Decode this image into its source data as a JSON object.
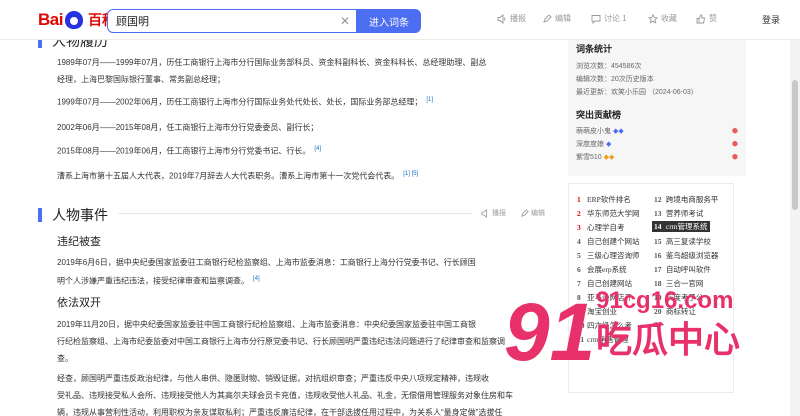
{
  "header": {
    "logo_bai": "Bai",
    "logo_du": "du",
    "logo_baike": "百科",
    "search_value": "顾国明",
    "search_placeholder": "",
    "enter_button": "进入词条",
    "tools": {
      "play": "播报",
      "edit": "编辑",
      "discuss": "讨论 1",
      "collect": "收藏",
      "like": "赞"
    },
    "login": "登录"
  },
  "main": {
    "career_heading_partial": "人物履历",
    "career": [
      {
        "text": "1989年07月——1999年07月，历任工商银行上海市分行国际业务部科员、资金科副科长、资金科科长、总经理助理、副总",
        "sup": ""
      },
      {
        "text": "经理，上海巴黎国际银行董事、常务副总经理；",
        "sup": ""
      },
      {
        "text": "1999年07月——2002年06月，历任工商银行上海市分行国际业务处代处长、处长，国际业务部总经理；",
        "sup": "[1]"
      },
      {
        "text": "2002年06月——2015年08月，任工商银行上海市分行党委委员、副行长；",
        "sup": ""
      },
      {
        "text": "2015年08月——2019年06月，任工商银行上海市分行党委书记、行长。",
        "sup": "[4]"
      },
      {
        "text": "漕系上海市第十五届人大代表，2019年7月辞去人大代表职务。漕系上海市第十一次党代会代表。",
        "sup": "[1]  [5]"
      }
    ],
    "events_heading": "人物事件",
    "events_tools": {
      "play": "播报",
      "edit": "编辑"
    },
    "sub1_title": "违纪被查",
    "sub1_lines": [
      "2019年6月6日，据中央纪委国家监委驻工商银行纪检监察组、上海市监委消息：工商银行上海分行党委书记、行长顾国",
      "明个人涉嫌严重违纪违法，接受纪律审查和监察调查。"
    ],
    "sub1_sup": "[4]",
    "sub2_title": "依法双开",
    "sub2_lines": [
      "2019年11月20日，据中央纪委国家监委驻中国工商银行纪检监察组、上海市监委消息：中央纪委国家监委驻中国工商银",
      "行纪检监察组、上海市纪委监委对中国工商银行上海市分行原党委书记、行长顾国明严重违纪违法问题进行了纪律审查和监察调",
      "查。"
    ],
    "sub2_p2_lines": [
      "经查，顾国明严重违反政治纪律，与他人串供、隐匿财物、销毁证据，对抗组织审查；严重违反中央八项规定精神，违规收",
      "受礼品、违规接受私人会所、违规接受他人为其高尔夫球会员卡充值，违规收受他人礼品、礼金，无偿借用管理服务对象住房和车",
      "辆，违规从事营利性活动，利用职权为亲友谋取私利；严重违反廉洁纪律，在干部选拔任用过程中，为关系人“量身定做”选拔任"
    ]
  },
  "sidebar": {
    "stats_title": "词条统计",
    "stats": [
      "浏览次数：454586次",
      "编辑次数：20次历史版本",
      "最近更新：欢笑小乐园 （2024-06-03）"
    ],
    "contrib_title": "突出贡献榜",
    "contributors": [
      "萌萌皮小鬼",
      "深度度娘",
      "紫雪510"
    ],
    "rank_items": [
      {
        "num": "1",
        "label": "ERP软件排名"
      },
      {
        "num": "12",
        "label": "跨境电商服务平"
      },
      {
        "num": "2",
        "label": "华东师范大学网"
      },
      {
        "num": "13",
        "label": "营养师考试"
      },
      {
        "num": "3",
        "label": "心理学自考"
      },
      {
        "num": "14",
        "label": "crm管理系统"
      },
      {
        "num": "4",
        "label": "自己创建个网站"
      },
      {
        "num": "15",
        "label": "高三复读学校"
      },
      {
        "num": "5",
        "label": "三级心理咨询师"
      },
      {
        "num": "16",
        "label": "鉴鸟超级浏览器"
      },
      {
        "num": "6",
        "label": "会展erp系统"
      },
      {
        "num": "17",
        "label": "自动呼叫软件"
      },
      {
        "num": "7",
        "label": "自己创建网站"
      },
      {
        "num": "18",
        "label": "三合一官网"
      },
      {
        "num": "8",
        "label": "亚马逊网店开"
      },
      {
        "num": "19",
        "label": "灰度考了公"
      },
      {
        "num": "9",
        "label": "淘宝创业"
      },
      {
        "num": "20",
        "label": "商标转让"
      },
      {
        "num": "10",
        "label": "四六级怎么考"
      },
      {
        "num": "21",
        "label": ""
      },
      {
        "num": "11",
        "label": "crm销售管理"
      },
      {
        "num": "22",
        "label": ""
      }
    ]
  },
  "watermark": {
    "number": "91",
    "domain": "91cg16.com",
    "text": "吃瓜中心"
  },
  "colors": {
    "accent": "#4e6ef2",
    "brand_red": "#e10602",
    "link": "#136ec2",
    "watermark": "#e8316b"
  }
}
